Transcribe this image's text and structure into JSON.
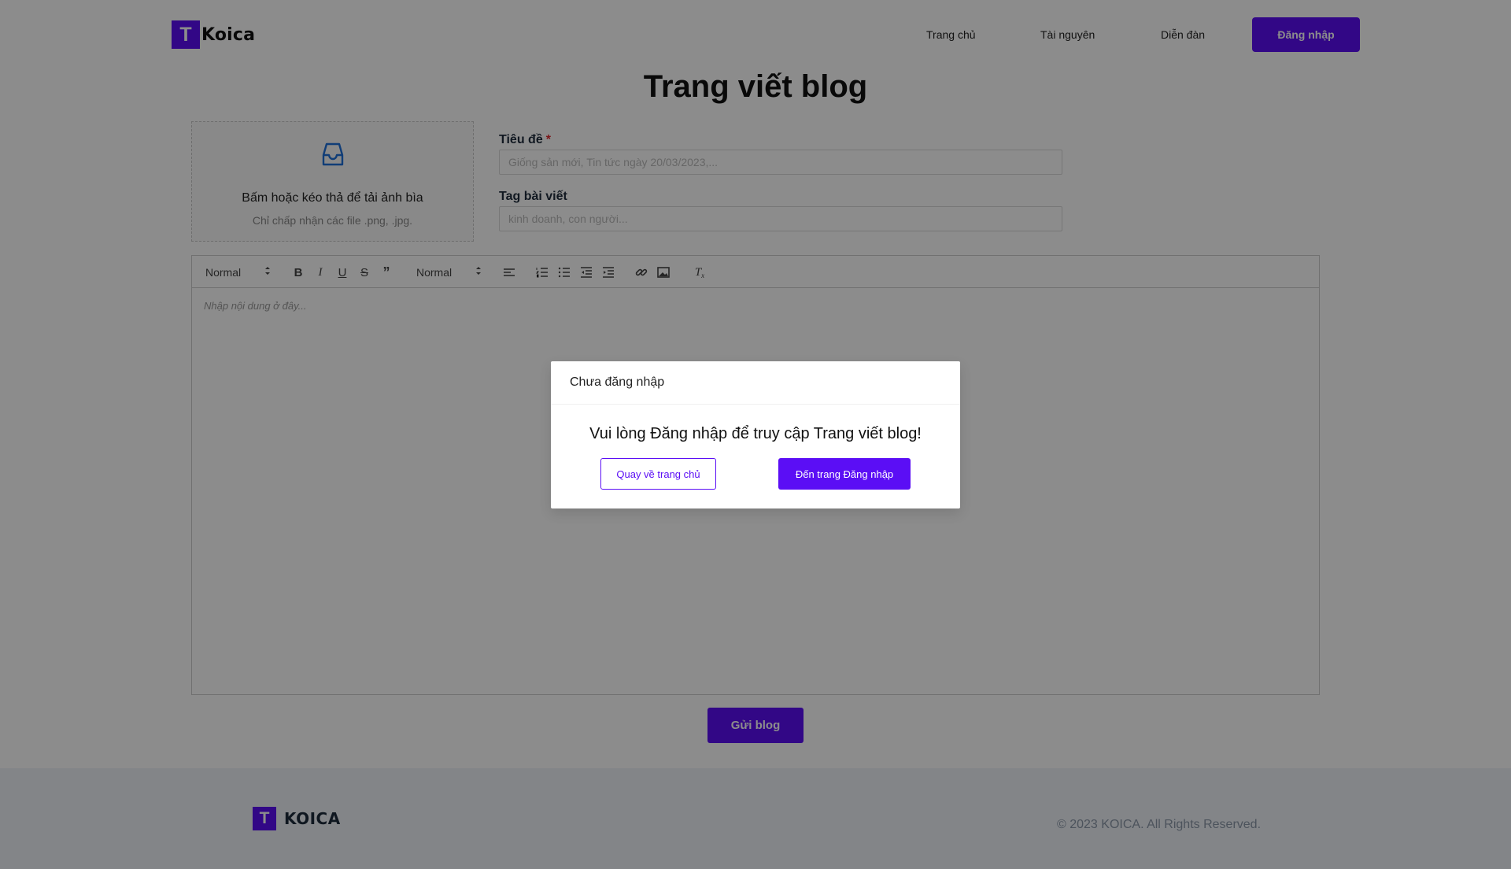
{
  "brand": {
    "logo_letter": "T",
    "name": "Koica",
    "footer_name": "KOICA",
    "accent": "#5b0ef5"
  },
  "nav": {
    "home": "Trang chủ",
    "resources": "Tài nguyên",
    "forum": "Diễn đàn",
    "login": "Đăng nhập"
  },
  "page": {
    "title": "Trang viết blog",
    "upload": {
      "text": "Bấm hoặc kéo thả để tải ảnh bìa",
      "hint": "Chỉ chấp nhận các file .png, .jpg.",
      "icon": "inbox-icon"
    },
    "title_field": {
      "label": "Tiêu đề",
      "required_mark": "*",
      "placeholder": "Giống sản mới, Tin tức ngày 20/03/2023,..."
    },
    "tag_field": {
      "label": "Tag bài viết",
      "placeholder": "kinh doanh, con người..."
    },
    "editor": {
      "header_select": "Normal",
      "size_select": "Normal",
      "placeholder": "Nhập nội dung ở đây..."
    },
    "submit": "Gửi blog"
  },
  "footer": {
    "copyright": "© 2023 KOICA. All Rights Reserved."
  },
  "modal": {
    "title": "Chưa đăng nhập",
    "message": "Vui lòng Đăng nhập để truy cập Trang viết blog!",
    "back_home": "Quay về trang chủ",
    "go_login": "Đến trang Đăng nhập"
  }
}
